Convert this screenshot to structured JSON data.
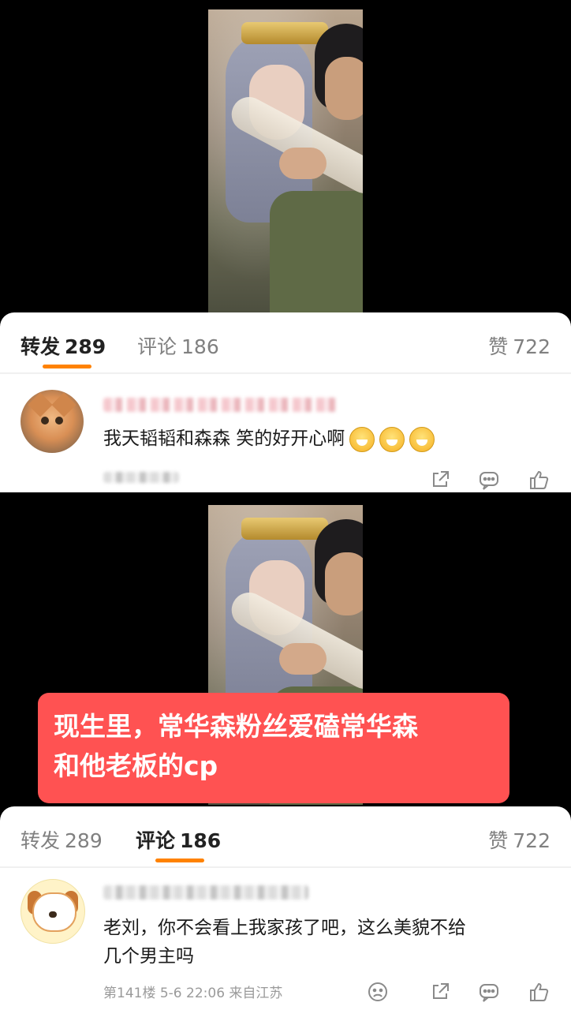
{
  "panel1": {
    "tabs": [
      {
        "label": "转发",
        "count": "289",
        "active": true
      },
      {
        "label": "评论",
        "count": "186",
        "active": false
      }
    ],
    "likes": {
      "label": "赞",
      "count": "722"
    },
    "comment": {
      "text": "我天韬韬和森森 笑的好开心啊"
    }
  },
  "panel2": {
    "tabs": [
      {
        "label": "转发",
        "count": "289",
        "active": false
      },
      {
        "label": "评论",
        "count": "186",
        "active": true
      }
    ],
    "likes": {
      "label": "赞",
      "count": "722"
    },
    "comment": {
      "line1": "老刘，你不会看上我家孩了吧，这么美貌不给",
      "line2": "几个男主吗",
      "meta": "第141楼  5-6 22:06  来自江苏"
    }
  },
  "banner": {
    "line1": "现生里，常华森粉丝爱磕常华森",
    "line2": "和他老板的cp"
  },
  "colors": {
    "accent": "#ff8200",
    "banner": "#ff5252"
  },
  "icons": [
    "share-icon",
    "comment-icon",
    "like-icon",
    "sad-face-icon"
  ]
}
